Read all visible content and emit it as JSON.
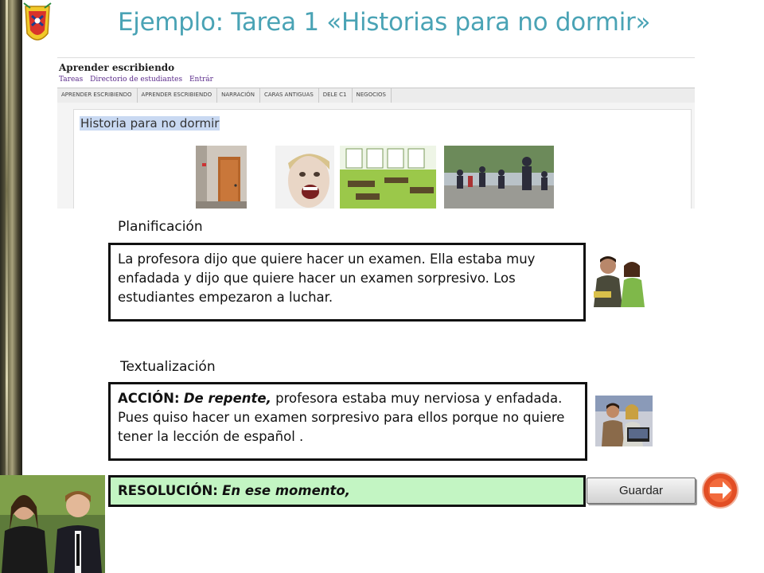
{
  "slide": {
    "title": "Ejemplo: Tarea 1 «Historias para no dormir»"
  },
  "website": {
    "title": "Aprender escribiendo",
    "nav": [
      "Tareas",
      "Directorio de estudiantes",
      "Entrár"
    ],
    "tabs": [
      "APRENDER ESCRIBIENDO",
      "APRENDER ESCRIBIENDO",
      "NARRACIÓN",
      "CARAS ANTIGUAS",
      "DELE C1",
      "NEGOCIOS"
    ],
    "heading": "Historia para no dormir"
  },
  "planificacion": {
    "label": "Planificación",
    "text": "La profesora dijo que quiere hacer un examen. Ella estaba muy enfadada y dijo que quiere hacer un examen sorpresivo. Los estudiantes empezaron a luchar."
  },
  "textualizacion": {
    "label": "Textualización",
    "accion_label": "ACCIÓN:",
    "accion_connector": "De repente,",
    "accion_text": " profesora estaba muy nerviosa y enfadada. Pues quiso hacer un examen sorpresivo para ellos porque no quiere tener la lección de español ."
  },
  "resolucion": {
    "label": "RESOLUCIÓN:",
    "connector": "En ese momento,"
  },
  "buttons": {
    "save_label": "Guardar"
  },
  "icons": {
    "next": "next-arrow-icon",
    "logo": "coat-of-arms-logo"
  },
  "colors": {
    "title": "#4aa3b5",
    "resolution_background": "#c3f5c3",
    "next_button": "#e8502a"
  }
}
